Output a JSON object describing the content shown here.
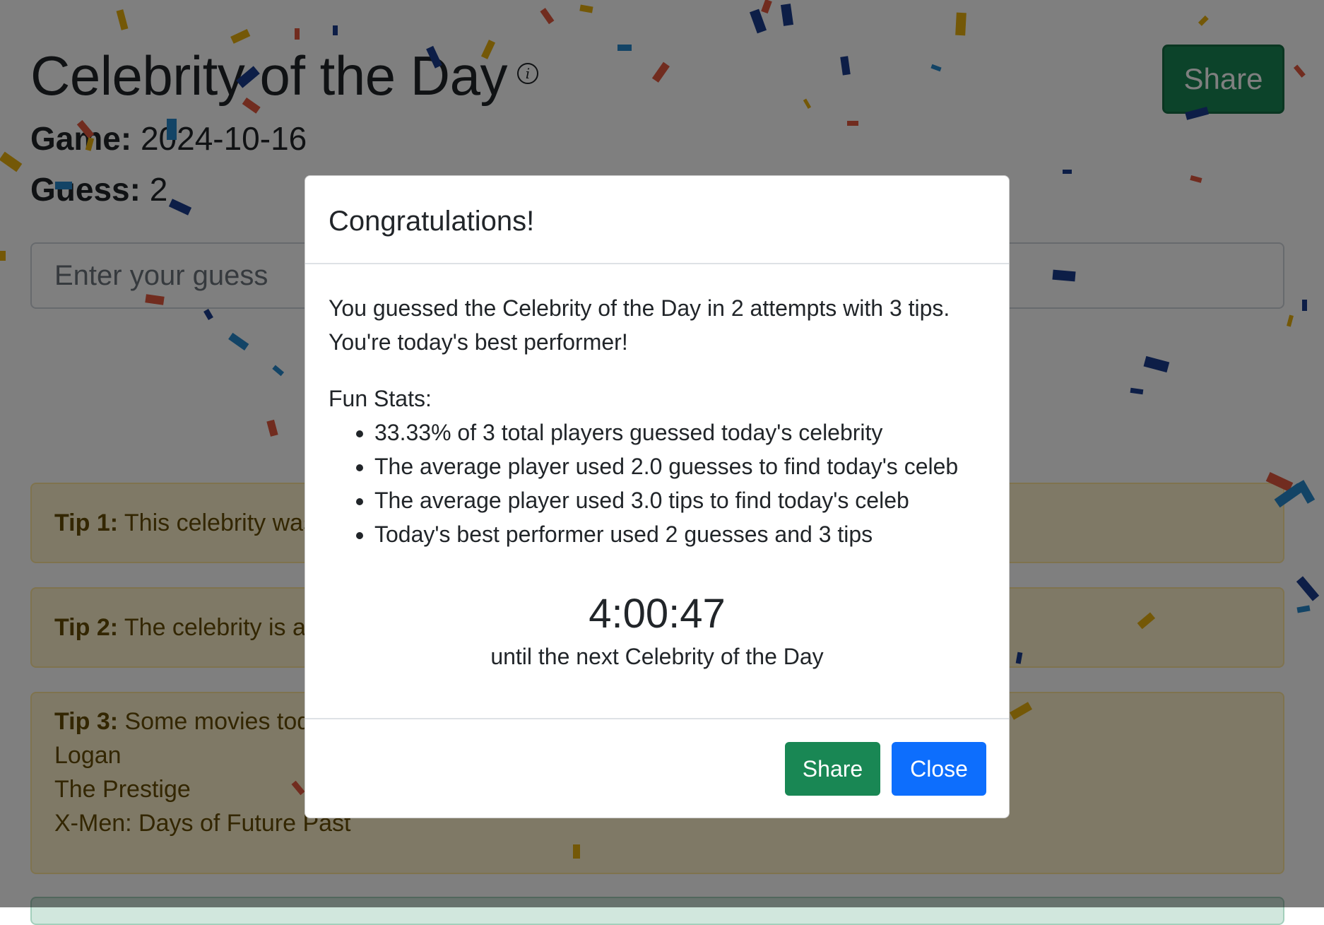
{
  "header": {
    "title": "Celebrity of the Day",
    "info_icon": "info-circle-icon",
    "share_label": "Share"
  },
  "meta": {
    "game_label": "Game:",
    "game_value": "2024-10-16",
    "guess_label": "Guess:",
    "guess_value": "2"
  },
  "guess_input": {
    "placeholder": "Enter your guess",
    "value": ""
  },
  "tips": [
    {
      "label": "Tip 1:",
      "text": "This celebrity was"
    },
    {
      "label": "Tip 2:",
      "text": "The celebrity is a"
    },
    {
      "label": "Tip 3:",
      "text": "Some movies toda",
      "lines": [
        "Logan",
        "The Prestige",
        "X-Men: Days of Future Past"
      ]
    }
  ],
  "modal": {
    "title": "Congratulations!",
    "message_line1": "You guessed the Celebrity of the Day in 2 attempts with 3 tips.",
    "message_line2": "You're today's best performer!",
    "stats_heading": "Fun Stats:",
    "stats": [
      "33.33% of 3 total players guessed today's celebrity",
      "The average player used 2.0 guesses to find today's celeb",
      "The average player used 3.0 tips to find today's celeb",
      "Today's best performer used 2 guesses and 3 tips"
    ],
    "countdown": "4:00:47",
    "countdown_caption": "until the next Celebrity of the Day",
    "share_label": "Share",
    "close_label": "Close"
  },
  "colors": {
    "primary": "#0d6efd",
    "success": "#198754",
    "tip_background": "#fff3cd",
    "tip_text": "#664d03",
    "confetti": [
      "#e8b10f",
      "#1b3c8f",
      "#e2583e",
      "#2788cc"
    ]
  }
}
